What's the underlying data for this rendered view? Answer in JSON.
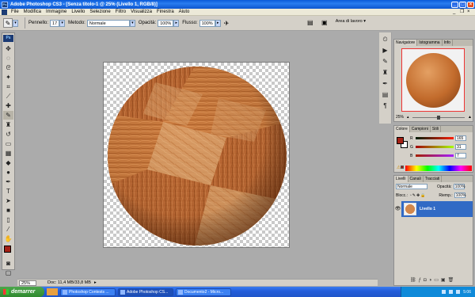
{
  "window": {
    "app_badge": "Ps",
    "title": "Adobe Photoshop CS3 - [Senza titolo-1 @ 25% (Livello 1, RGB/8)]"
  },
  "menu": [
    "File",
    "Modifica",
    "Immagine",
    "Livello",
    "Selezione",
    "Filtro",
    "Visualizza",
    "Finestra",
    "Aiuto"
  ],
  "options": {
    "brush_label": "Pennello:",
    "brush_size": "17",
    "mode_label": "Metodo:",
    "mode_value": "Normale",
    "opacity_label": "Opacità:",
    "opacity_value": "100%",
    "flow_label": "Flusso:",
    "flow_value": "100%",
    "workspace_label": "Area di lavoro ▾"
  },
  "statusbar": {
    "zoom": "25%",
    "doc_info": "Doc: 11,4 MB/33,8 MB"
  },
  "navigator": {
    "tabs": [
      "Navigatore",
      "Istogramma",
      "Info"
    ],
    "zoom": "25%",
    "zoom_fraction": 0.48
  },
  "color_panel": {
    "tabs": [
      "Colore",
      "Campioni",
      "Stili"
    ],
    "sliders": [
      {
        "label": "R",
        "value": "165"
      },
      {
        "label": "G",
        "value": "31"
      },
      {
        "label": "B",
        "value": "7"
      }
    ],
    "foreground": "#a52014",
    "background": "#ffffff"
  },
  "layers_panel": {
    "tabs": [
      "Livelli",
      "Canali",
      "Tracciati"
    ],
    "blend_mode": "Normale",
    "opacity_label": "Opacità:",
    "opacity_value": "100%",
    "lock_label": "Blocc.:",
    "fill_label": "Riemp.:",
    "fill_value": "100%",
    "layer_name": "Livello 1"
  },
  "taskbar": {
    "start_label": "demarrer",
    "tasks": [
      "Photoshop Contests ...",
      "Adobe Photoshop CS...",
      "Documento2 - Micro..."
    ],
    "clock": "5:06"
  },
  "colors": {
    "wood_light": "#d8935a",
    "wood_dark": "#9a4a18",
    "accent_blue": "#316ac5"
  }
}
